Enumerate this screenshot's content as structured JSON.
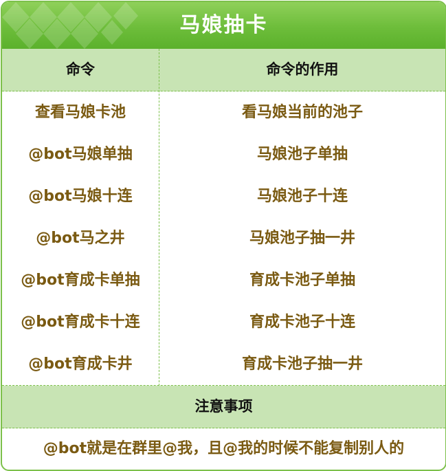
{
  "title": "马娘抽卡",
  "table": {
    "headers": [
      "命令",
      "命令的作用"
    ],
    "rows": [
      {
        "command": "查看马娘卡池",
        "effect": "看马娘当前的池子"
      },
      {
        "command": "@bot马娘单抽",
        "effect": "马娘池子单抽"
      },
      {
        "command": "@bot马娘十连",
        "effect": "马娘池子十连"
      },
      {
        "command": "@bot马之井",
        "effect": "马娘池子抽一井"
      },
      {
        "command": "@bot育成卡单抽",
        "effect": "育成卡池子单抽"
      },
      {
        "command": "@bot育成卡十连",
        "effect": "育成卡池子十连"
      },
      {
        "command": "@bot育成卡井",
        "effect": "育成卡池子抽一井"
      }
    ]
  },
  "notes": {
    "title": "注意事项",
    "text": "@bot就是在群里@我，且@我的时候不能复制别人的"
  },
  "colors": {
    "header_green": "#6dbd3a",
    "row_header_bg": "#c8e4b4",
    "border_green": "#7cc04a",
    "cell_text": "#7a5a12"
  }
}
